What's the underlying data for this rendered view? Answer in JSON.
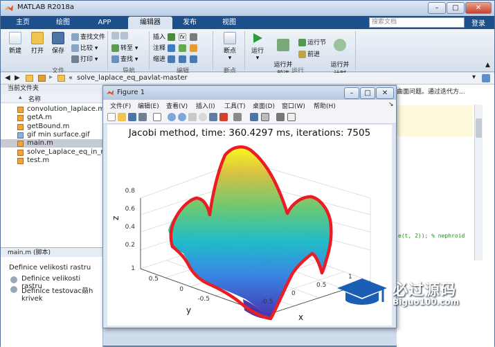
{
  "app": {
    "title": "MATLAB R2018a"
  },
  "titlebar": {
    "minimize": "–",
    "maximize": "□",
    "close": "✕"
  },
  "tabs": [
    {
      "label": "主页"
    },
    {
      "label": "绘图"
    },
    {
      "label": "APP"
    },
    {
      "label": "编辑器"
    },
    {
      "label": "发布"
    },
    {
      "label": "视图"
    }
  ],
  "search": {
    "placeholder": "搜索文档"
  },
  "login_label": "登录",
  "ribbon": {
    "new_label": "新建",
    "open_label": "打开",
    "save_label": "保存",
    "find_files": "查找文件",
    "compare": "比较",
    "print": "打印",
    "goto": "转至",
    "find": "查找",
    "insert": "插入",
    "comment": "注释",
    "indent": "缩进",
    "breakpoints": "断点",
    "run": "运行",
    "run_advance": "运行并\n前进",
    "run_section": "运行节",
    "advance": "前进",
    "run_time": "运行并\n计时",
    "groups": {
      "file": "文件",
      "nav": "导航",
      "edit": "编辑",
      "breakpoints": "断点",
      "run": "运行"
    }
  },
  "pathbar": {
    "path": "solve_laplace_eq_pavlat-master",
    "prefix": "«"
  },
  "current_folder": {
    "header": "当前文件夹",
    "column": "名称",
    "files": [
      {
        "name": "convolution_laplace.m",
        "selected": false
      },
      {
        "name": "getA.m",
        "selected": false
      },
      {
        "name": "getBound.m",
        "selected": false
      },
      {
        "name": "gif min surface.gif",
        "selected": false
      },
      {
        "name": "main.m",
        "selected": true
      },
      {
        "name": "solve_Laplace_eq_in_matl",
        "selected": false
      },
      {
        "name": "test.m",
        "selected": false
      }
    ]
  },
  "details": {
    "header": "main.m  (脚本)",
    "title": "Definice velikosti rastru",
    "items": [
      "Definice velikosti rastru",
      "Definice testovac赑h krivek"
    ]
  },
  "editor": {
    "note": "曲面问题。通过迭代方...",
    "code": "e(t, 2)); % nephroid"
  },
  "figure": {
    "title": "Figure 1",
    "menu": [
      "文件(F)",
      "编辑(E)",
      "查看(V)",
      "插入(I)",
      "工具(T)",
      "桌面(D)",
      "窗口(W)",
      "帮助(H)"
    ],
    "plot_title": "Jacobi method, time: 360.4297 ms, iterations: 7505",
    "z_label": "z",
    "y_label": "y",
    "x_label": "x",
    "z_ticks": [
      "0.8",
      "0.6",
      "0.4",
      "0.2"
    ],
    "y_ticks": [
      "1",
      "0.5",
      "0",
      "-0.5"
    ],
    "x_ticks": [
      "-0.5",
      "0",
      "0.5",
      "1"
    ]
  },
  "watermark": {
    "main": "必过源码",
    "sub": "Biguo100.com"
  }
}
